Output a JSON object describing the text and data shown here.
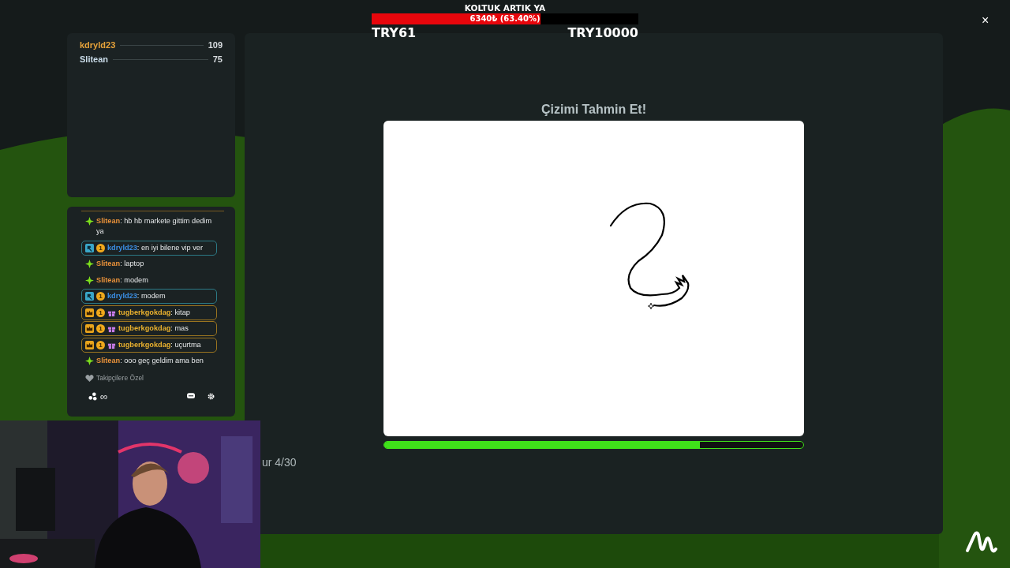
{
  "donation_goal": {
    "title": "KOLTUK ARTIK YA",
    "amount": "6340₺ (63.40%)",
    "level": 0.634,
    "start": "TRY61",
    "target": "TRY10000"
  },
  "leaderboard": [
    {
      "name": "kdryld23",
      "score": "109",
      "color": "#e8a33a"
    },
    {
      "name": "Slitean",
      "score": "75",
      "color": "#c9dbe8"
    }
  ],
  "chat": {
    "messages": [
      {
        "kind": "plain",
        "user": "Slitean",
        "text": ": hb hb markete gittim dedim ya"
      },
      {
        "kind": "mod",
        "badge": "1",
        "user": "kdryld23",
        "text": ": en iyi bilene vip ver"
      },
      {
        "kind": "plain",
        "user": "Slitean",
        "text": ": laptop"
      },
      {
        "kind": "plain",
        "user": "Slitean",
        "text": ": modem"
      },
      {
        "kind": "mod",
        "badge": "1",
        "user": "kdryld23",
        "text": ": modem"
      },
      {
        "kind": "vip",
        "badge": "1",
        "user": "tugberkgokdag",
        "text": ": kitap"
      },
      {
        "kind": "vip",
        "badge": "1",
        "user": "tugberkgokdag",
        "text": ": mas"
      },
      {
        "kind": "vip",
        "badge": "1",
        "user": "tugberkgokdag",
        "text": ": uçurtma"
      },
      {
        "kind": "plain",
        "user": "Slitean",
        "text": ": ooo geç geldim ama ben"
      }
    ],
    "footer": "Takipçilere Özel",
    "viewers": "∞"
  },
  "game": {
    "title": "Çizimi Tahmin Et!",
    "level": 0.754,
    "round": "ur 4/30"
  },
  "close": "×"
}
